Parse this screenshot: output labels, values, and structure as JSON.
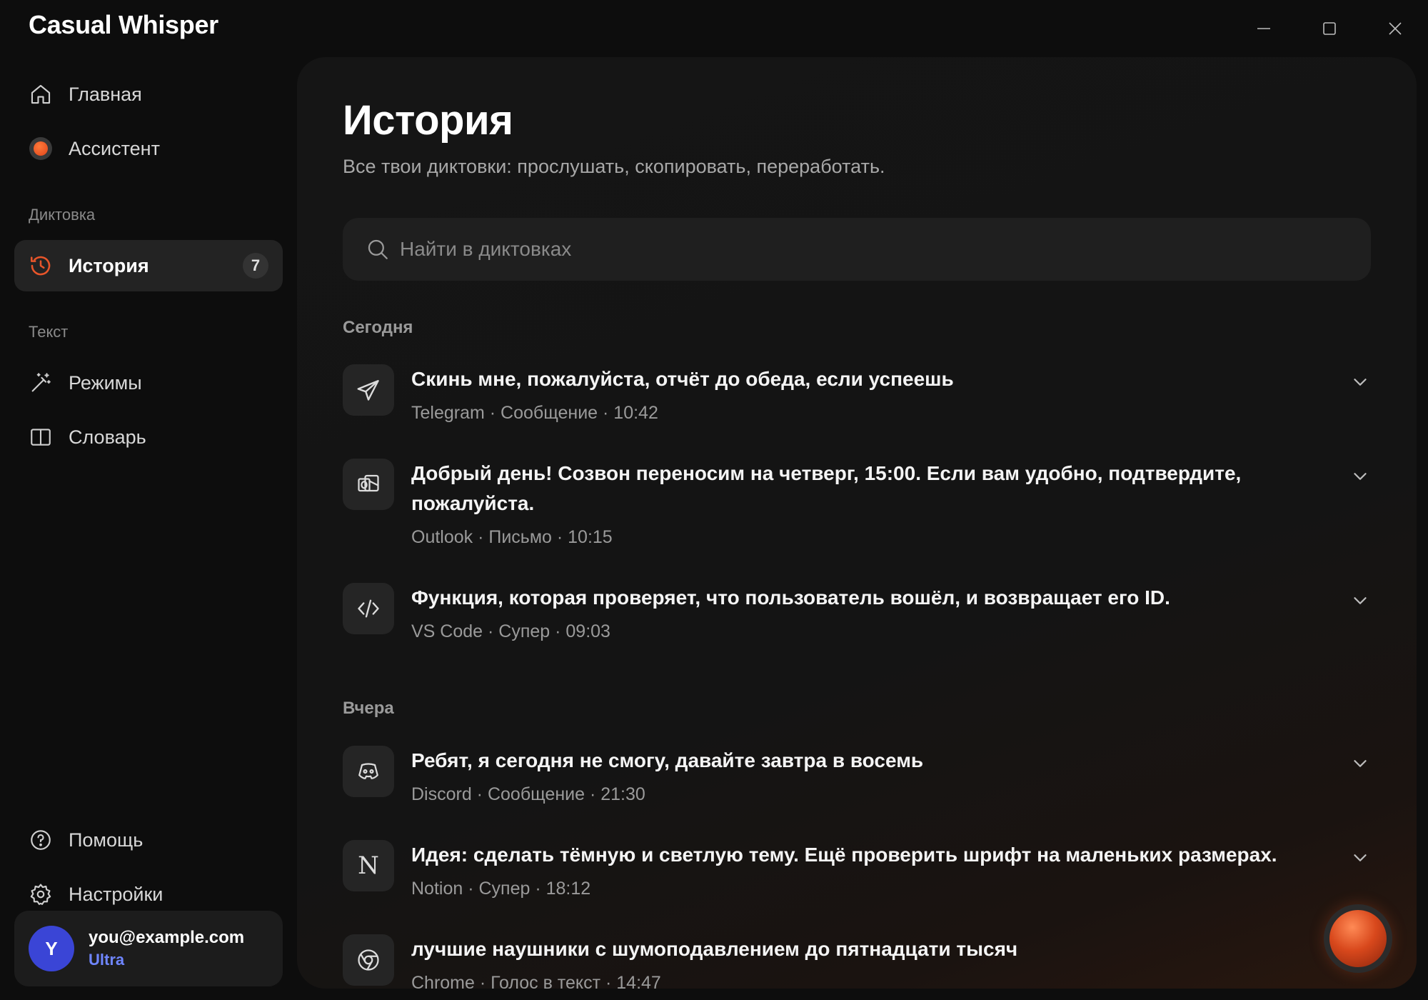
{
  "app": {
    "title": "Casual Whisper"
  },
  "sidebar": {
    "nav_top": [
      {
        "label": "Главная",
        "icon": "home-icon"
      },
      {
        "label": "Ассистент",
        "icon": "record-dot-icon"
      }
    ],
    "section_dictation": "Диктовка",
    "history": {
      "label": "История",
      "count": "7",
      "icon": "history-icon"
    },
    "section_text": "Текст",
    "nav_text": [
      {
        "label": "Режимы",
        "icon": "magic-wand-icon"
      },
      {
        "label": "Словарь",
        "icon": "book-icon"
      }
    ],
    "nav_bottom": [
      {
        "label": "Помощь",
        "icon": "help-icon"
      },
      {
        "label": "Настройки",
        "icon": "gear-icon"
      }
    ],
    "user": {
      "initial": "Y",
      "email": "you@example.com",
      "plan": "Ultra"
    }
  },
  "main": {
    "title": "История",
    "subtitle": "Все твои диктовки: прослушать, скопировать, переработать.",
    "search": {
      "placeholder": "Найти в диктовках"
    },
    "groups": [
      {
        "label": "Сегодня",
        "entries": [
          {
            "icon": "telegram-icon",
            "text": "Скинь мне, пожалуйста, отчёт до обеда, если успеешь",
            "meta": "Telegram · Сообщение · 10:42"
          },
          {
            "icon": "outlook-icon",
            "text": "Добрый день! Созвон переносим на четверг, 15:00. Если вам удобно, подтвердите, пожалуйста.",
            "meta": "Outlook · Письмо · 10:15"
          },
          {
            "icon": "code-icon",
            "text": "Функция, которая проверяет, что пользователь вошёл, и возвращает его ID.",
            "meta": "VS Code · Супер · 09:03"
          }
        ]
      },
      {
        "label": "Вчера",
        "entries": [
          {
            "icon": "discord-icon",
            "text": "Ребят, я сегодня не смогу, давайте завтра в восемь",
            "meta": "Discord · Сообщение · 21:30"
          },
          {
            "icon": "notion-icon",
            "glyph": "N",
            "text": "Идея: сделать тёмную и светлую тему. Ещё проверить шрифт на маленьких размерах.",
            "meta": "Notion · Супер · 18:12"
          },
          {
            "icon": "chrome-icon",
            "text": "лучшие наушники с шумоподавлением до пятнадцати тысяч",
            "meta": "Chrome · Голос в текст · 14:47"
          }
        ]
      }
    ]
  },
  "colors": {
    "accent": "#e8552a",
    "plan": "#6f86ff",
    "avatar": "#3a45d6"
  }
}
